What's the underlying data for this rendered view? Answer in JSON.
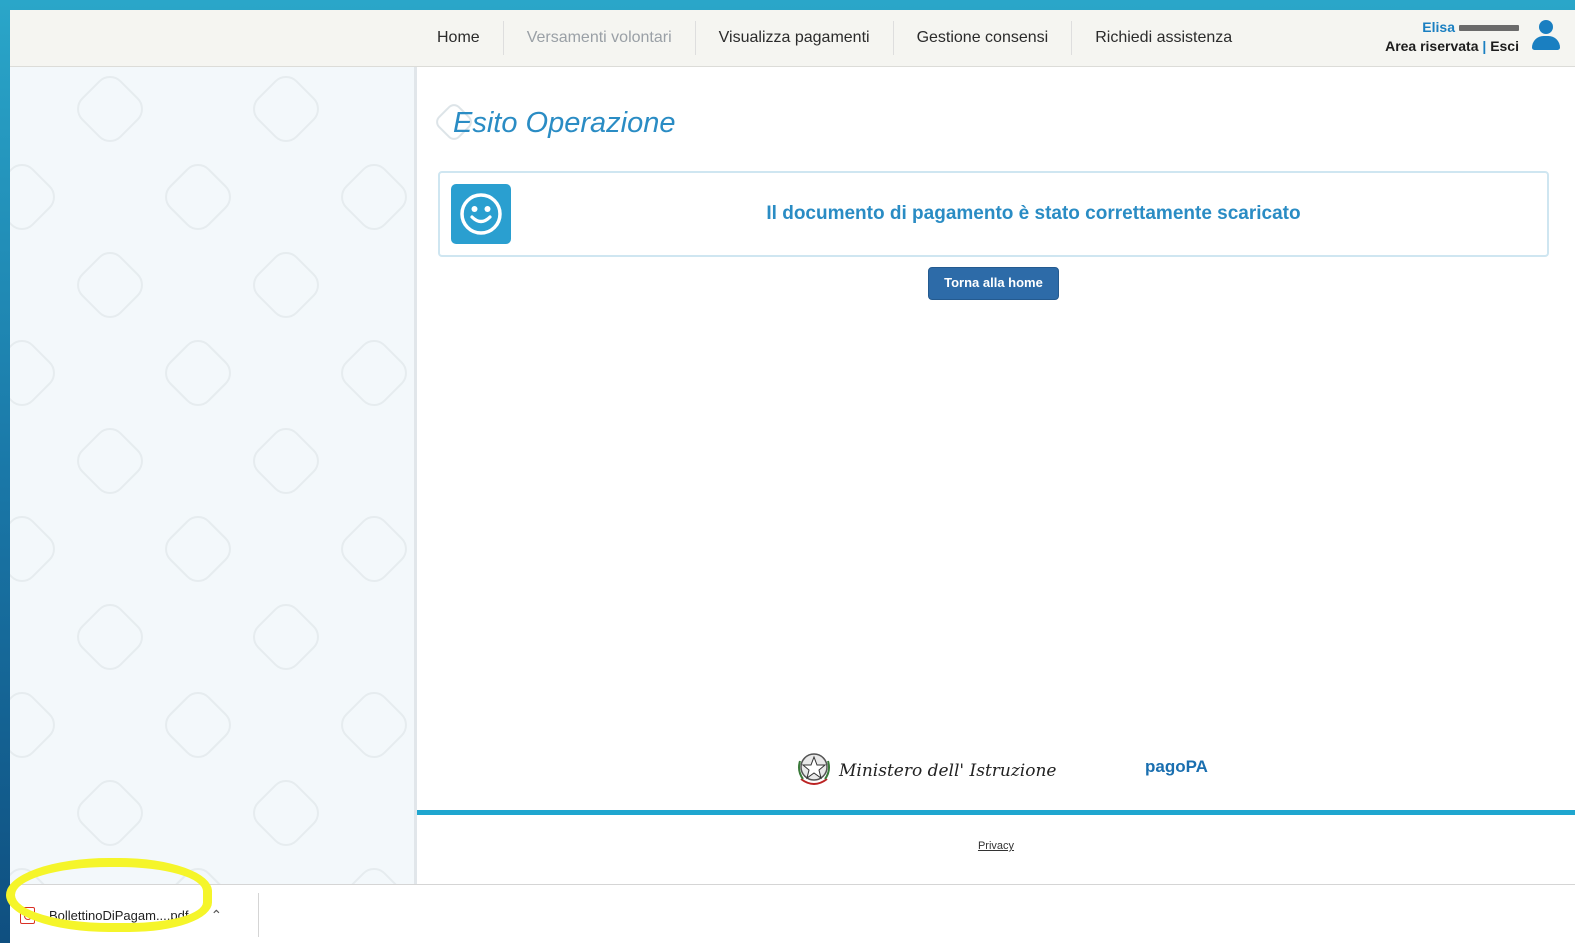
{
  "nav": {
    "items": [
      {
        "label": "Home",
        "disabled": false
      },
      {
        "label": "Versamenti volontari",
        "disabled": true
      },
      {
        "label": "Visualizza pagamenti",
        "disabled": false
      },
      {
        "label": "Gestione consensi",
        "disabled": false
      },
      {
        "label": "Richiedi assistenza",
        "disabled": false
      }
    ]
  },
  "user": {
    "name": "Elisa",
    "area_label": "Area riservata",
    "separator": "|",
    "logout_label": "Esci"
  },
  "main": {
    "title": "Esito Operazione",
    "message": "Il documento di pagamento è stato correttamente scaricato",
    "home_button": "Torna alla home"
  },
  "footer": {
    "ministry": "Ministero dell' Istruzione",
    "pagopa": "pagoPA",
    "privacy": "Privacy"
  },
  "downloads": {
    "file_name": "BollettinoDiPagam....pdf"
  },
  "colors": {
    "accent": "#2a8cc4",
    "button": "#2d6ba8",
    "footer_bar": "#1fa6cf",
    "highlight": "#f5f52a"
  }
}
